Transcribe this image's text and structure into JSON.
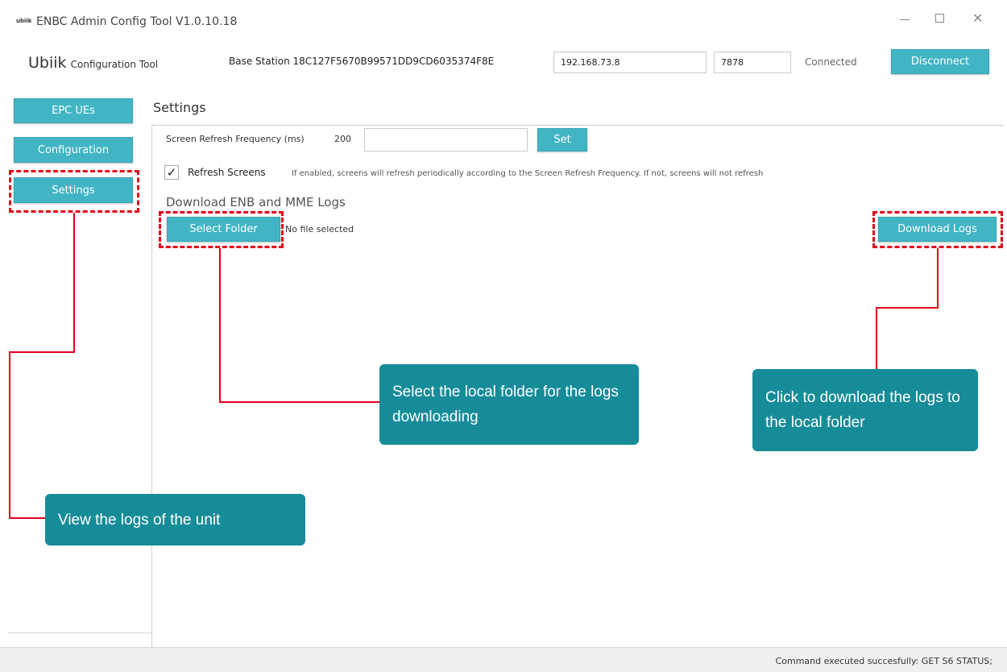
{
  "window": {
    "logo_text": "ubiik",
    "title": "ENBC Admin Config Tool V1.0.10.18"
  },
  "header": {
    "brand": "Ubiik",
    "brand_sub": "Configuration Tool",
    "base_station": "Base Station 18C127F5670B99571DD9CD6035374F8E",
    "ip_value": "192.168.73.8",
    "port_value": "7878",
    "status": "Connected",
    "disconnect_label": "Disconnect"
  },
  "sidebar": {
    "items": [
      {
        "label": "EPC UEs"
      },
      {
        "label": "Configuration"
      },
      {
        "label": "Settings"
      }
    ]
  },
  "settings": {
    "heading": "Settings",
    "refresh_label": "Screen Refresh Frequency (ms)",
    "refresh_value": "200",
    "set_label": "Set",
    "refresh_screens_label": "Refresh Screens",
    "refresh_screens_desc": "If enabled, screens will refresh periodically according to the Screen Refresh Frequency. If not, screens will not refresh",
    "logs_heading": "Download ENB and MME Logs",
    "select_folder_label": "Select Folder",
    "no_file_text": "No file selected",
    "download_logs_label": "Download Logs"
  },
  "callouts": {
    "select_folder": "Select the local folder for the logs downloading",
    "download_logs": "Click to download the logs to the local folder",
    "view_logs": "View the logs of the unit"
  },
  "statusbar": {
    "text": "Command executed succesfully: GET S6 STATUS;"
  }
}
